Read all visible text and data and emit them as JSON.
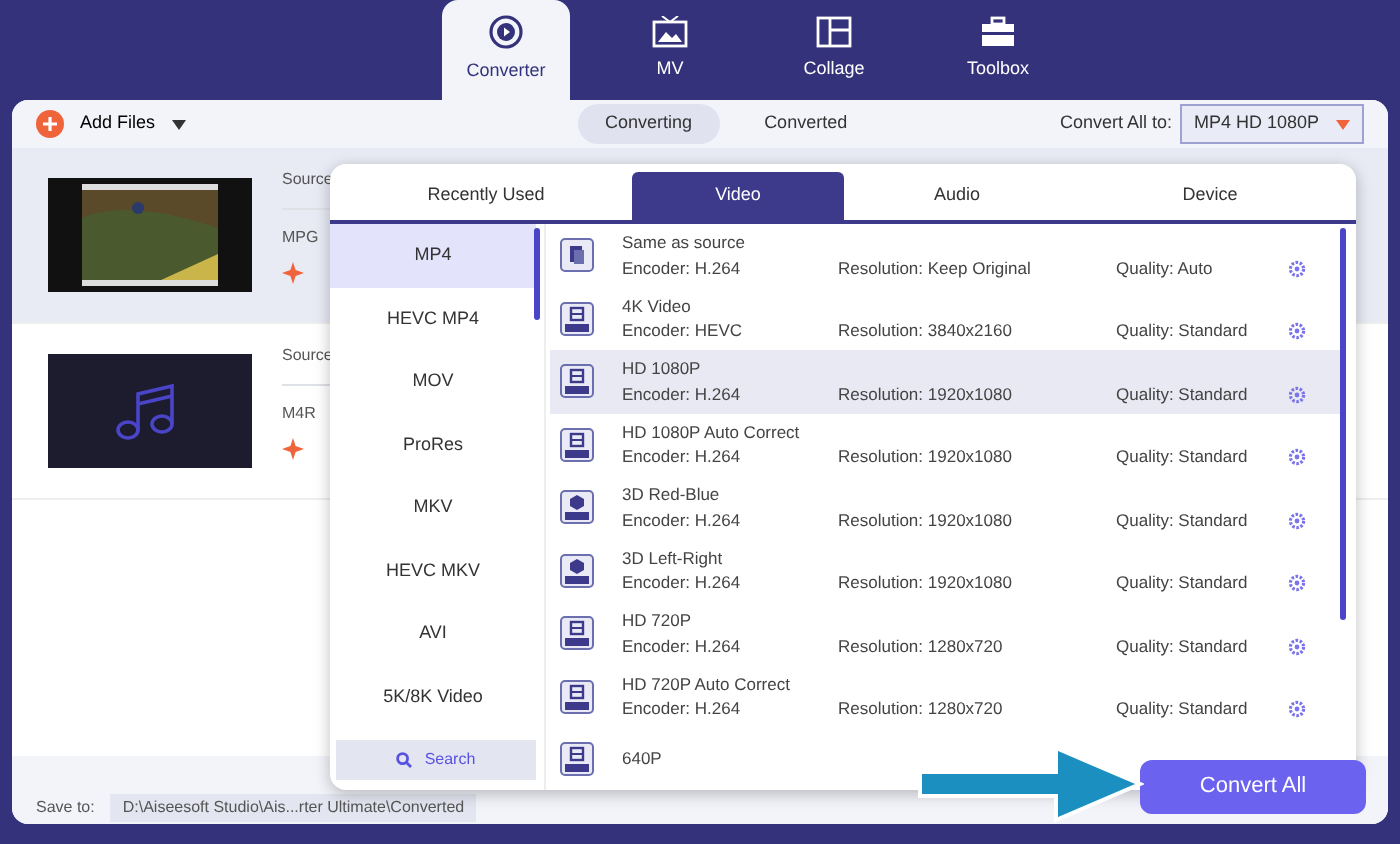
{
  "nav_tabs": [
    {
      "label": "Converter",
      "selected": true
    },
    {
      "label": "MV",
      "selected": false
    },
    {
      "label": "Collage",
      "selected": false
    },
    {
      "label": "Toolbox",
      "selected": false
    }
  ],
  "toolbar": {
    "add_files": "Add Files",
    "view_tabs": [
      {
        "label": "Converting",
        "selected": true
      },
      {
        "label": "Converted",
        "selected": false
      }
    ],
    "convert_all_label": "Convert All to:",
    "convert_all_value": "MP4 HD 1080P"
  },
  "files": [
    {
      "kind": "video",
      "selected": true,
      "source_label": "Source",
      "format": "MPG"
    },
    {
      "kind": "audio",
      "selected": false,
      "source_label": "Source",
      "format": "M4R"
    }
  ],
  "save_to": {
    "label": "Save to:",
    "path": "D:\\Aiseesoft Studio\\Ais...rter Ultimate\\Converted"
  },
  "convert_button": "Convert All",
  "format_popup": {
    "tabs": [
      {
        "label": "Recently Used",
        "selected": false
      },
      {
        "label": "Video",
        "selected": true
      },
      {
        "label": "Audio",
        "selected": false
      },
      {
        "label": "Device",
        "selected": false
      }
    ],
    "categories": [
      {
        "label": "MP4",
        "selected": true
      },
      {
        "label": "HEVC MP4",
        "selected": false
      },
      {
        "label": "MOV",
        "selected": false
      },
      {
        "label": "ProRes",
        "selected": false
      },
      {
        "label": "MKV",
        "selected": false
      },
      {
        "label": "HEVC MKV",
        "selected": false
      },
      {
        "label": "AVI",
        "selected": false
      },
      {
        "label": "5K/8K Video",
        "selected": false
      }
    ],
    "search": "Search",
    "presets": [
      {
        "kind": "same",
        "name": "Same as source",
        "encoder": "Encoder: H.264",
        "resolution": "Resolution: Keep Original",
        "quality": "Quality: Auto",
        "selected": false
      },
      {
        "kind": "hd",
        "name": "4K Video",
        "encoder": "Encoder: HEVC",
        "resolution": "Resolution: 3840x2160",
        "quality": "Quality: Standard",
        "selected": false
      },
      {
        "kind": "hd",
        "name": "HD 1080P",
        "encoder": "Encoder: H.264",
        "resolution": "Resolution: 1920x1080",
        "quality": "Quality: Standard",
        "selected": true
      },
      {
        "kind": "hd",
        "name": "HD 1080P Auto Correct",
        "encoder": "Encoder: H.264",
        "resolution": "Resolution: 1920x1080",
        "quality": "Quality: Standard",
        "selected": false
      },
      {
        "kind": "stereo",
        "name": "3D Red-Blue",
        "encoder": "Encoder: H.264",
        "resolution": "Resolution: 1920x1080",
        "quality": "Quality: Standard",
        "selected": false
      },
      {
        "kind": "stereo",
        "name": "3D Left-Right",
        "encoder": "Encoder: H.264",
        "resolution": "Resolution: 1920x1080",
        "quality": "Quality: Standard",
        "selected": false
      },
      {
        "kind": "hd",
        "name": "HD 720P",
        "encoder": "Encoder: H.264",
        "resolution": "Resolution: 1280x720",
        "quality": "Quality: Standard",
        "selected": false
      },
      {
        "kind": "hd",
        "name": "HD 720P Auto Correct",
        "encoder": "Encoder: H.264",
        "resolution": "Resolution: 1280x720",
        "quality": "Quality: Standard",
        "selected": false
      },
      {
        "kind": "hd",
        "name": "640P",
        "selected": false
      }
    ]
  }
}
